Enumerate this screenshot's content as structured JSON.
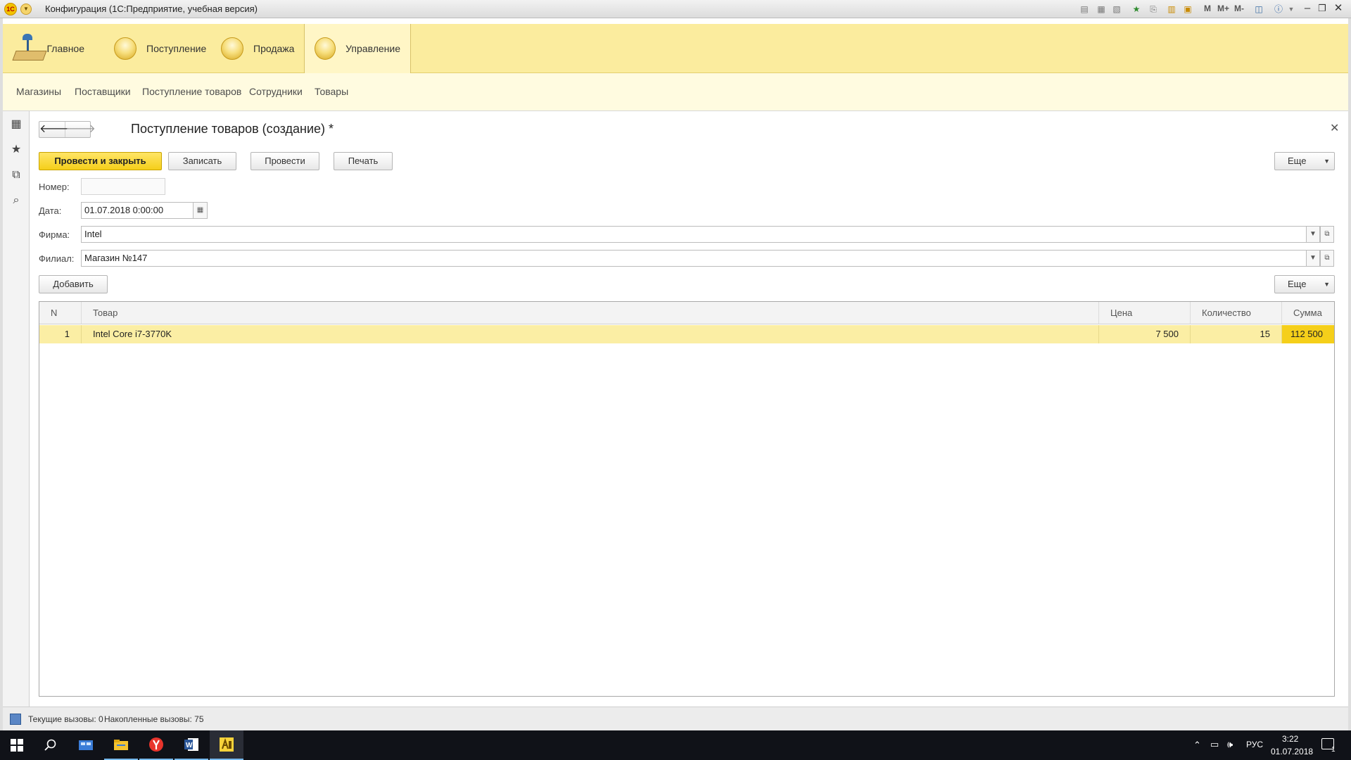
{
  "window": {
    "title": "Конфигурация  (1С:Предприятие, учебная версия)",
    "logo_text": "1С",
    "toolbar_m_labels": [
      "M",
      "M+",
      "M-"
    ]
  },
  "sections": [
    {
      "label": "Главное",
      "icon": "home-desk-icon"
    },
    {
      "label": "Поступление",
      "icon": "section-ball-icon"
    },
    {
      "label": "Продажа",
      "icon": "section-ball-icon"
    },
    {
      "label": "Управление",
      "icon": "section-ball-icon",
      "active": true
    }
  ],
  "nav_links": [
    "Магазины",
    "Поставщики",
    "Поступление товаров",
    "Сотрудники",
    "Товары"
  ],
  "form": {
    "title": "Поступление товаров (создание) *",
    "buttons": {
      "post_and_close": "Провести и закрыть",
      "write": "Записать",
      "post": "Провести",
      "print": "Печать",
      "more": "Еще",
      "add": "Добавить",
      "more_table": "Еще"
    },
    "fields": {
      "number": {
        "label": "Номер:",
        "value": ""
      },
      "date": {
        "label": "Дата:",
        "value": "01.07.2018  0:00:00"
      },
      "firm": {
        "label": "Фирма:",
        "value": "Intel"
      },
      "branch": {
        "label": "Филиал:",
        "value": "Магазин №147"
      }
    },
    "table": {
      "columns": [
        "N",
        "Товар",
        "Цена",
        "Количество",
        "Сумма"
      ],
      "rows": [
        {
          "n": "1",
          "item": "Intel Core i7-3770K",
          "price": "7 500",
          "qty": "15",
          "sum": "112 500"
        }
      ]
    }
  },
  "statusbar": {
    "current_calls": "Текущие вызовы: 0",
    "accumulated_calls": "Накопленные вызовы: 75"
  },
  "taskbar": {
    "language": "РУС",
    "time": "3:22",
    "date": "01.07.2018",
    "notification_count": "1"
  },
  "colors": {
    "section_bg": "#fbec9e",
    "nav_bg": "#fffbe0",
    "primary_button": "#f5cf1a",
    "row_highlight": "#fbeea4",
    "taskbar": "#101218"
  }
}
